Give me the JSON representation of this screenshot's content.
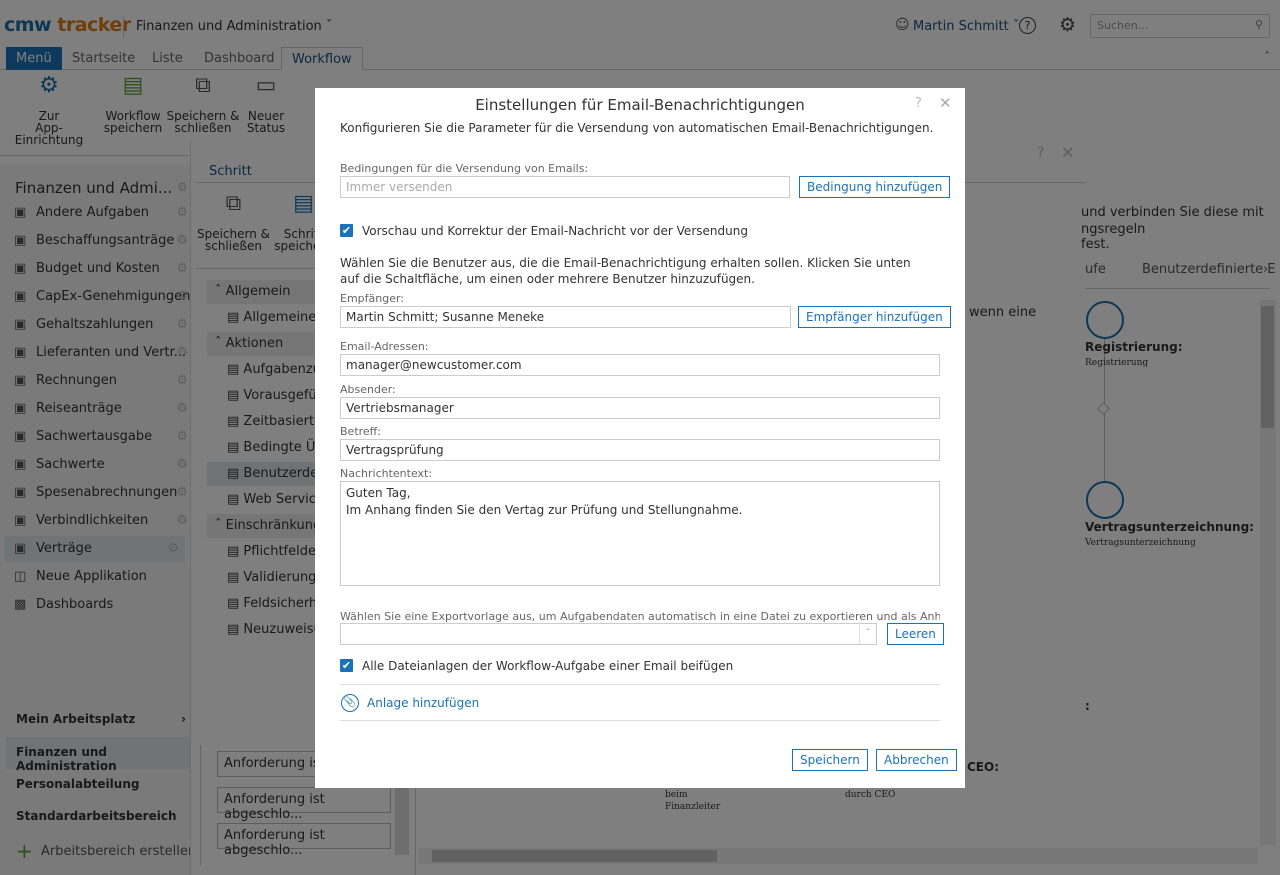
{
  "header": {
    "logo": "cmw tracker",
    "logo_a": "cmw",
    "logo_b": "tracker",
    "workspace": "Finanzen und Administration",
    "user": "Martin Schmitt",
    "search_placeholder": "Suchen..."
  },
  "tabs": [
    "Menü",
    "Startseite",
    "Liste",
    "Dashboard",
    "Workflow"
  ],
  "toolbar": [
    {
      "label1": "Zur",
      "label2": "App-Einrichtung",
      "icon": "gear-back-icon"
    },
    {
      "label1": "Workflow",
      "label2": "speichern",
      "icon": "save-icon"
    },
    {
      "label1": "Speichern &",
      "label2": "schließen",
      "icon": "save-close-icon"
    },
    {
      "label1": "Neuer",
      "label2": "Status",
      "icon": "new-status-icon"
    }
  ],
  "sidebar": {
    "title": "Finanzen und Admi...",
    "items": [
      "Andere Aufgaben",
      "Beschaffungsanträge",
      "Budget und Kosten",
      "CapEx-Genehmigungen",
      "Gehaltszahlungen",
      "Lieferanten und Vertr...",
      "Rechnungen",
      "Reiseanträge",
      "Sachwertausgabe",
      "Sachwerte",
      "Spesenabrechnungen",
      "Verbindlichkeiten",
      "Verträge"
    ],
    "selected": "Verträge",
    "extra": [
      "Neue Applikation",
      "Dashboards"
    ],
    "workspaces": [
      "Mein Arbeitsplatz",
      "Finanzen und Administration",
      "Personalabteilung",
      "Standardarbeitsbereich"
    ],
    "create": "Arbeitsbereich erstellen"
  },
  "step_dialog": {
    "tab": "Schritt",
    "tools": [
      {
        "l1": "Speichern &",
        "l2": "schließen"
      },
      {
        "l1": "Schritt",
        "l2": "speichern"
      }
    ],
    "tree": [
      {
        "t": "Allgemein",
        "h": true
      },
      {
        "t": "Allgemeine E"
      },
      {
        "t": "Aktionen",
        "h": true
      },
      {
        "t": "Aufgabenzuw"
      },
      {
        "t": "Vorausgefül"
      },
      {
        "t": "Zeitbasierte"
      },
      {
        "t": "Bedingte Üb"
      },
      {
        "t": "Benutzerdef",
        "sel": true
      },
      {
        "t": "Web Service"
      },
      {
        "t": "Einschränkunge",
        "h": true
      },
      {
        "t": "Pflichtfelder"
      },
      {
        "t": "Validierungs"
      },
      {
        "t": "Feldsicherhe"
      },
      {
        "t": "Neuzuweisu"
      }
    ],
    "conditions": [
      "Anforderung ist a",
      "Anforderung ist abgeschlo...",
      "Anforderung ist abgeschlo..."
    ],
    "right_text1": "und verbinden Sie diese mit",
    "right_text2": "ngsregeln fest.",
    "right_text3": "wenn eine",
    "tab_partial": "ufe",
    "tab_custom": "Benutzerdefinierte E",
    "nodes": [
      {
        "title": "Registrierung:",
        "sub": "Registrierung"
      },
      {
        "title": "Vertragsunterzeichnung:",
        "sub": "Vertragsunterzeichnung"
      }
    ],
    "bottom_labels": [
      "CEO:",
      "beim",
      "Finanzleiter",
      "durch CEO"
    ]
  },
  "modal": {
    "title": "Einstellungen für Email-Benachrichtigungen",
    "description": "Konfigurieren Sie die Parameter für die Versendung von automatischen Email-Benachrichtigungen.",
    "conditions_label": "Bedingungen für die Versendung von Emails:",
    "conditions_placeholder": "Immer versenden",
    "add_condition": "Bedingung hinzufügen",
    "preview_label": "Vorschau und Korrektur der Email-Nachricht vor der Versendung",
    "preview_checked": true,
    "users_hint": "Wählen Sie die Benutzer aus, die die Email-Benachrichtigung erhalten sollen. Klicken Sie unten auf die Schaltfläche, um einen oder mehrere Benutzer hinzuzufügen.",
    "recipients_label": "Empfänger:",
    "recipients_value": "Martin Schmitt; Susanne Meneke",
    "add_recipient": "Empfänger hinzufügen",
    "emails_label": "Email-Adressen:",
    "emails_value": "manager@newcustomer.com",
    "sender_label": "Absender:",
    "sender_value": "Vertriebsmanager",
    "subject_label": "Betreff:",
    "subject_value": "Vertragsprüfung",
    "body_label": "Nachrichtentext:",
    "body_line1": "Guten Tag,",
    "body_line2": "Im Anhang finden Sie den Vertag zur Prüfung und Stellungnahme.",
    "export_label": "Wählen Sie eine Exportvorlage aus, um Aufgabendaten automatisch in eine Datei zu exportieren und als Anhang zu...",
    "export_value": "",
    "clear": "Leeren",
    "attach_all_label": "Alle Dateianlagen der Workflow-Aufgabe einer Email beifügen",
    "attach_all_checked": true,
    "add_attachment": "Anlage hinzufügen",
    "save": "Speichern",
    "cancel": "Abbrechen"
  },
  "colors": {
    "accent": "#1a73b8",
    "logo_orange": "#e07b1a"
  }
}
